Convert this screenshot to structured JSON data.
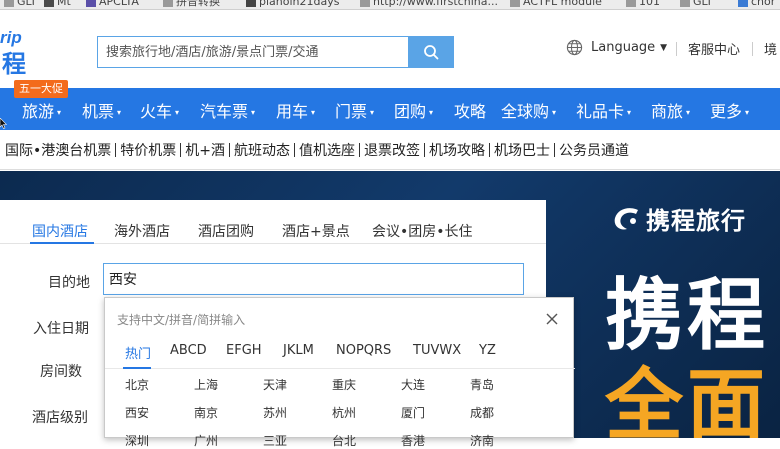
{
  "bookmarks": [
    {
      "label": "GLI",
      "icon": "page-icon",
      "color": "#9a9a9a"
    },
    {
      "label": "Mt",
      "icon": "google-icon",
      "color": "#4a4a4a"
    },
    {
      "label": "APCLTA",
      "icon": "app-icon",
      "color": "#5a4fa8"
    },
    {
      "label": "拼音转换",
      "icon": "page-icon",
      "color": "#9a9a9a"
    },
    {
      "label": "planoln21days",
      "icon": "wordpress-icon",
      "color": "#444444"
    },
    {
      "label": "http://www.firstchina...",
      "icon": "page-icon",
      "color": "#9a9a9a"
    },
    {
      "label": "ACTFL module",
      "icon": "cloud-icon",
      "color": "#9a9a9a"
    },
    {
      "label": "101",
      "icon": "page-icon",
      "color": "#9a9a9a"
    },
    {
      "label": "GLI",
      "icon": "page-icon",
      "color": "#9a9a9a"
    },
    {
      "label": "chor",
      "icon": "globe-icon",
      "color": "#3b7bd4"
    }
  ],
  "header": {
    "logo_top": "rip",
    "logo_bottom": "程",
    "search_placeholder": "搜索旅行地/酒店/旅游/景点门票/交通",
    "language": "Language",
    "service": "客服中心",
    "region": "境"
  },
  "promo_badge": "五一大促",
  "nav": [
    {
      "label": "旅游",
      "dropdown": true
    },
    {
      "label": "机票",
      "dropdown": true
    },
    {
      "label": "火车",
      "dropdown": true
    },
    {
      "label": "汽车票",
      "dropdown": true
    },
    {
      "label": "用车",
      "dropdown": true
    },
    {
      "label": "门票",
      "dropdown": true
    },
    {
      "label": "团购",
      "dropdown": true
    },
    {
      "label": "攻略",
      "dropdown": false
    },
    {
      "label": "全球购",
      "dropdown": true
    },
    {
      "label": "礼品卡",
      "dropdown": true
    },
    {
      "label": "商旅",
      "dropdown": true
    },
    {
      "label": "更多",
      "dropdown": true
    }
  ],
  "subnav": [
    "国际•港澳台机票",
    "特价机票",
    "机+酒",
    "航班动态",
    "值机选座",
    "退票改签",
    "机场攻略",
    "机场巴士",
    "公务员通道"
  ],
  "hero": {
    "brand": "携程旅行",
    "big_line1": "携程",
    "big_line2": "全面"
  },
  "hotel": {
    "tabs": [
      "国内酒店",
      "海外酒店",
      "酒店团购",
      "酒店+景点",
      "会议•团房•长住"
    ],
    "active_tab": 0,
    "labels": [
      "目的地",
      "入住日期",
      "房间数",
      "酒店级别"
    ],
    "destination_value": "西安"
  },
  "city_popup": {
    "hint": "支持中文/拼音/简拼输入",
    "tabs": [
      "热门",
      "ABCD",
      "EFGH",
      "JKLM",
      "NOPQRS",
      "TUVWX",
      "YZ"
    ],
    "active_tab": 0,
    "rows": [
      [
        "北京",
        "上海",
        "天津",
        "重庆",
        "大连",
        "青岛"
      ],
      [
        "西安",
        "南京",
        "苏州",
        "杭州",
        "厦门",
        "成都"
      ],
      [
        "深圳",
        "广州",
        "三亚",
        "台北",
        "香港",
        "济南"
      ]
    ]
  },
  "colors": {
    "brand_blue": "#2577e3",
    "promo_orange": "#f36b1c",
    "hero_yellow": "#f5a623"
  }
}
